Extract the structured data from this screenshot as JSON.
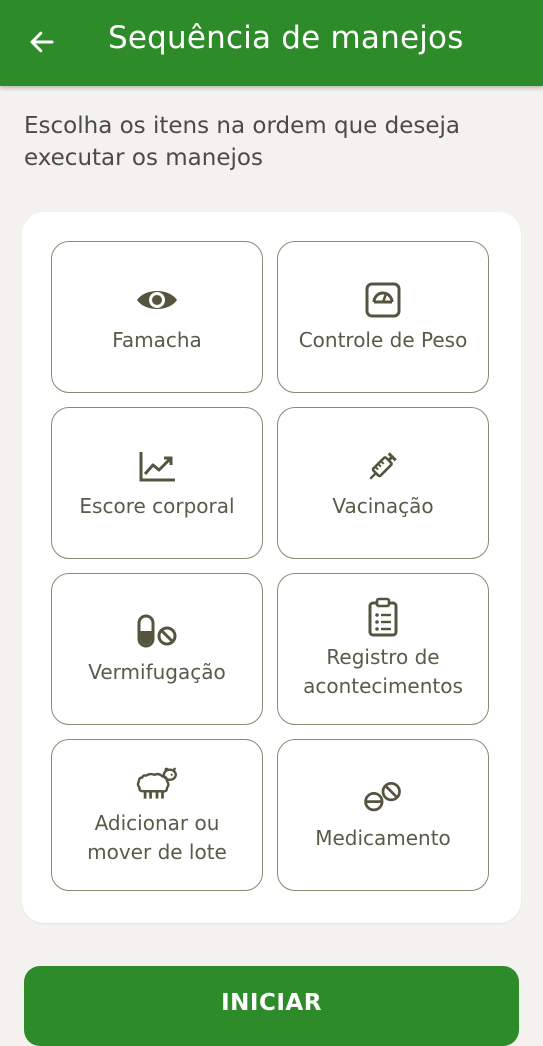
{
  "header": {
    "title": "Sequência de manejos",
    "back_icon": "arrow-left-icon",
    "background": "#2d8b2a"
  },
  "instructions": "Escolha os itens na ordem que deseja executar os manejos",
  "items": [
    {
      "label": "Famacha",
      "icon": "eye-icon"
    },
    {
      "label": "Controle de Peso",
      "icon": "scale-icon"
    },
    {
      "label": "Escore corporal",
      "icon": "trending-up-chart-icon"
    },
    {
      "label": "Vacinação",
      "icon": "syringe-icon"
    },
    {
      "label": "Vermifugação",
      "icon": "pill-capsule-icon"
    },
    {
      "label": "Registro de acontecimentos",
      "icon": "clipboard-list-icon"
    },
    {
      "label": "Adicionar ou mover de lote",
      "icon": "sheep-icon"
    },
    {
      "label": "Medicamento",
      "icon": "tablets-icon"
    }
  ],
  "start_button": {
    "label": "INICIAR",
    "color": "#2d8b2a"
  },
  "colors": {
    "icon": "#55553f",
    "tile_border": "#8a8a70"
  }
}
